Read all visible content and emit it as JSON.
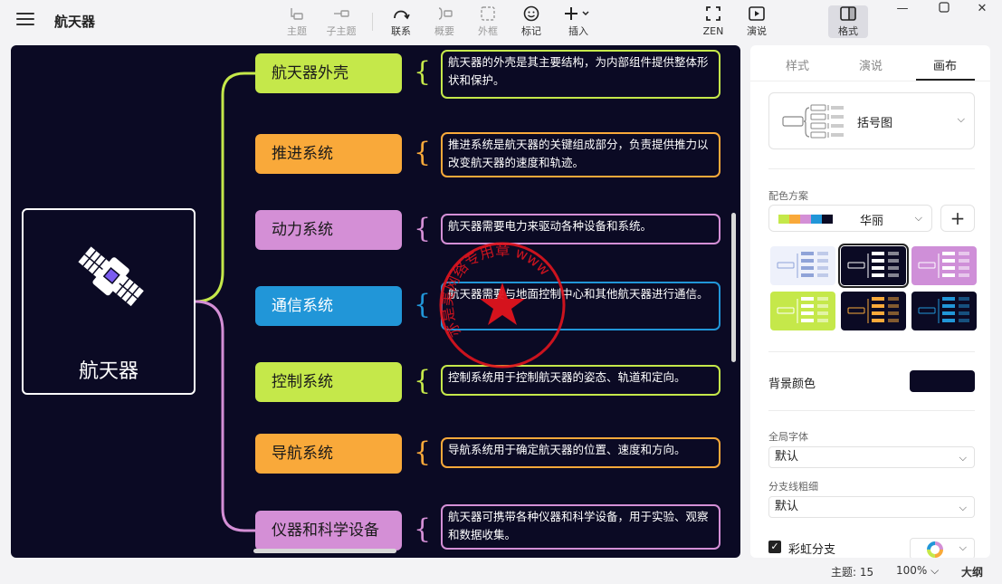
{
  "app": {
    "title": "航天器"
  },
  "toolbar": {
    "topic": {
      "label": "主题",
      "icon": "add-topic-icon"
    },
    "subtopic": {
      "label": "子主题",
      "icon": "add-subtopic-icon"
    },
    "relation": {
      "label": "联系",
      "icon": "relation-icon"
    },
    "summary": {
      "label": "概要",
      "icon": "summary-icon"
    },
    "boundary": {
      "label": "外框",
      "icon": "boundary-icon"
    },
    "marker": {
      "label": "标记",
      "icon": "marker-icon"
    },
    "insert": {
      "label": "插入",
      "icon": "insert-icon"
    },
    "zen": {
      "label": "ZEN",
      "icon": "zen-icon"
    },
    "pitch": {
      "label": "演说",
      "icon": "pitch-icon"
    },
    "format": {
      "label": "格式",
      "icon": "format-panel-icon"
    }
  },
  "mindmap": {
    "root": "航天器",
    "branches": [
      {
        "title": "航天器外壳",
        "desc": "航天器的外壳是其主要结构，为内部组件提供整体形状和保护。",
        "color": "#c5e84a"
      },
      {
        "title": "推进系统",
        "desc": "推进系统是航天器的关键组成部分，负责提供推力以改变航天器的速度和轨迹。",
        "color": "#f9a93a"
      },
      {
        "title": "动力系统",
        "desc": "航天器需要电力来驱动各种设备和系统。",
        "color": "#d48fd6"
      },
      {
        "title": "通信系统",
        "desc": "航天器需要与地面控制中心和其他航天器进行通信。",
        "color": "#2196d8"
      },
      {
        "title": "控制系统",
        "desc": "控制系统用于控制航天器的姿态、轨道和定向。",
        "color": "#c5e84a"
      },
      {
        "title": "导航系统",
        "desc": "导航系统用于确定航天器的位置、速度和方向。",
        "color": "#f9a93a"
      },
      {
        "title": "仪器和科学设备",
        "desc": "航天器可携带各种仪器和科学设备，用于实验、观察和数据收集。",
        "color": "#d48fd6"
      }
    ]
  },
  "watermark": {
    "text": "亦是美网络专用章 www.yishimei.cn",
    "color": "#e0141e"
  },
  "panel": {
    "tabs": [
      "样式",
      "演说",
      "画布"
    ],
    "active_tab": "画布",
    "structure": "括号图",
    "color_scheme_label": "配色方案",
    "color_scheme": "华丽",
    "color_swatches": [
      "#c5e84a",
      "#f9a93a",
      "#d48fd6",
      "#2196d8",
      "#0b0a24"
    ],
    "themes": [
      {
        "bg": "#eef1fb",
        "accent": "#8fa3d8"
      },
      {
        "bg": "#0b0a24",
        "accent": "#ffffff",
        "selected": true
      },
      {
        "bg": "#cf8fd8",
        "accent": "#ffffff"
      },
      {
        "bg": "#c5e84a",
        "accent": "#ffffff"
      },
      {
        "bg": "#0b0a24",
        "accent": "#f9a93a"
      },
      {
        "bg": "#0b0a24",
        "accent": "#2196d8"
      }
    ],
    "background_label": "背景颜色",
    "background_color": "#0b0a24",
    "font_label": "全局字体",
    "font_value": "默认",
    "branch_width_label": "分支线粗细",
    "branch_width_value": "默认",
    "rainbow_label": "彩虹分支",
    "rainbow_checked": true
  },
  "status": {
    "topics": "主题: 15",
    "zoom": "100%",
    "outline": "大纲"
  }
}
